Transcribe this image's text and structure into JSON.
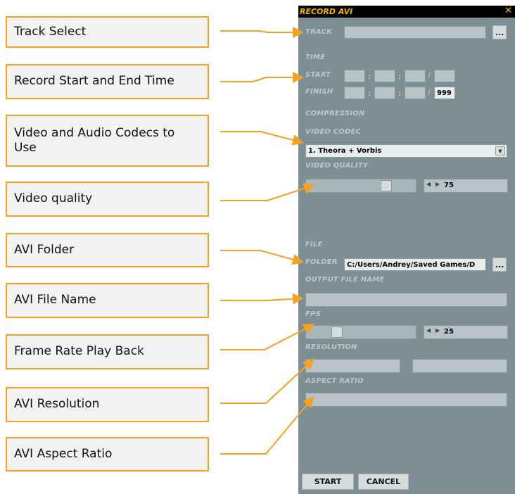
{
  "callouts": [
    {
      "text": "Track Select"
    },
    {
      "text": "Record Start and End Time"
    },
    {
      "text": "Video and Audio Codecs to Use"
    },
    {
      "text": "Video quality"
    },
    {
      "text": "AVI Folder"
    },
    {
      "text": "AVI File Name"
    },
    {
      "text": "Frame Rate Play Back"
    },
    {
      "text": "AVI Resolution"
    },
    {
      "text": "AVI Aspect Ratio"
    }
  ],
  "window": {
    "title": "RECORD AVI",
    "close": "✕"
  },
  "labels": {
    "track": "TRACK",
    "time": "TIME",
    "start": "START",
    "finish": "FINISH",
    "compression": "COMPRESSION",
    "video_codec": "VIDEO CODEC",
    "video_quality": "VIDEO QUALITY",
    "file": "FILE",
    "folder": "FOLDER",
    "output_file_name": "OUTPUT FILE NAME",
    "fps": "FPS",
    "resolution": "RESOLUTION",
    "aspect_ratio": "ASPECT RATIO"
  },
  "separators": {
    "colon": ":",
    "slash": "/"
  },
  "values": {
    "track": "",
    "finish_frames": "999",
    "video_codec": "1. Theora + Vorbis",
    "video_quality": "75",
    "folder": "C:/Users/Andrey/Saved Games/D",
    "output_file_name": "",
    "fps": "25",
    "resolution_width": "",
    "resolution_height": "",
    "aspect_ratio": ""
  },
  "buttons": {
    "browse": "...",
    "start": "START",
    "cancel": "CANCEL"
  },
  "spinner_arrows": "◀ ▶",
  "dropdown_arrow": "▼",
  "colors": {
    "callout_border": "#f4a124",
    "arrow": "#f4a124",
    "panel": "#7d8f94",
    "title": "#f4b400"
  }
}
